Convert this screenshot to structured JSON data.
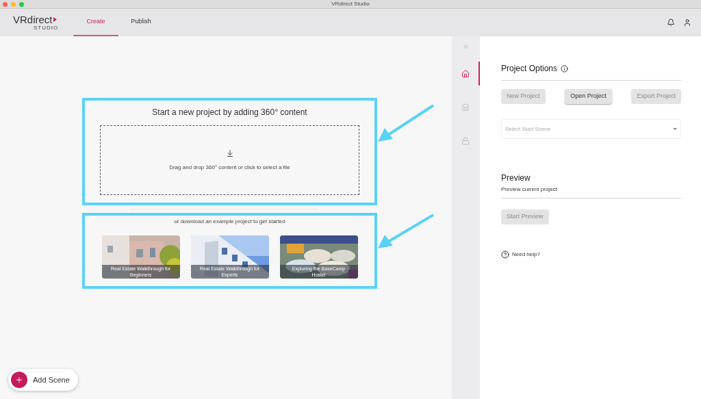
{
  "window": {
    "title": "VRdirect Studio"
  },
  "logo": {
    "brand": "VRdirect",
    "sub": "STUDIO"
  },
  "tabs": [
    {
      "label": "Create",
      "selected": true
    },
    {
      "label": "Publish",
      "selected": false
    }
  ],
  "upload": {
    "title": "Start a new project by adding 360° content",
    "hint": "Drag and drop 360° content or click to select a file"
  },
  "examples": {
    "caption": "or download an example project to get started",
    "items": [
      {
        "title": "Real Estate Walkthrough for Beginners",
        "kind": "house"
      },
      {
        "title": "Real Estate Walkthrough for Experts",
        "kind": "building"
      },
      {
        "title": "Exploring the BaseCamp Hostel",
        "kind": "caravans"
      }
    ]
  },
  "add_scene": {
    "label": "Add Scene"
  },
  "rail": [
    {
      "kind": "home",
      "selected": true
    },
    {
      "kind": "layers",
      "selected": false
    },
    {
      "kind": "lock",
      "selected": false
    }
  ],
  "project_options": {
    "title": "Project Options",
    "buttons": [
      {
        "label": "New Project",
        "disabled": true
      },
      {
        "label": "Open Project",
        "disabled": false
      },
      {
        "label": "Export Project",
        "disabled": true
      }
    ],
    "select": {
      "placeholder": "Select Start Scene"
    }
  },
  "preview": {
    "title": "Preview",
    "subtitle": "Preview current project",
    "button": {
      "label": "Start Preview",
      "disabled": true
    }
  },
  "help": {
    "label": "Need help?"
  }
}
